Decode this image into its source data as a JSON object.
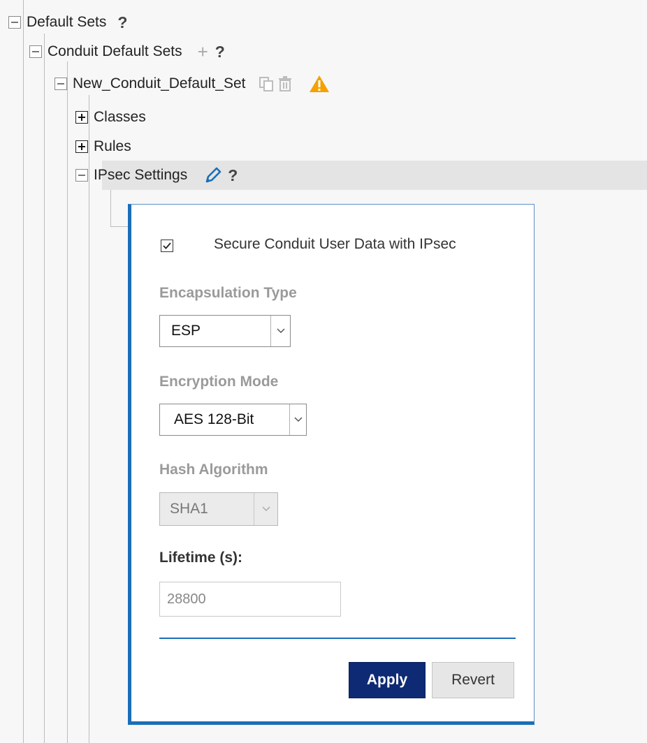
{
  "tree": {
    "root": {
      "label": "Default Sets",
      "help": "?"
    },
    "conduit": {
      "label": "Conduit Default Sets",
      "add": "+",
      "help": "?"
    },
    "set": {
      "label": "New_Conduit_Default_Set"
    },
    "classes": {
      "label": "Classes"
    },
    "rules": {
      "label": "Rules"
    },
    "ipsec": {
      "label": "IPsec Settings",
      "help": "?"
    }
  },
  "form": {
    "secure_checkbox": {
      "label": "Secure Conduit User Data with IPsec",
      "checked": true
    },
    "encapsulation": {
      "label": "Encapsulation Type",
      "value": "ESP"
    },
    "encryption": {
      "label": "Encryption Mode",
      "value": "AES 128-Bit"
    },
    "hash": {
      "label": "Hash Algorithm",
      "value": "SHA1",
      "disabled": true
    },
    "lifetime": {
      "label": "Lifetime (s):",
      "placeholder": "28800"
    },
    "apply_label": "Apply",
    "revert_label": "Revert"
  },
  "colors": {
    "accent": "#1a6fb7",
    "apply_bg": "#0f2a74",
    "warning": "#f5a100",
    "edit_icon": "#1a6fb7"
  },
  "icons": [
    "copy-icon",
    "trash-icon",
    "warning-icon",
    "pencil-icon",
    "help-icon"
  ]
}
